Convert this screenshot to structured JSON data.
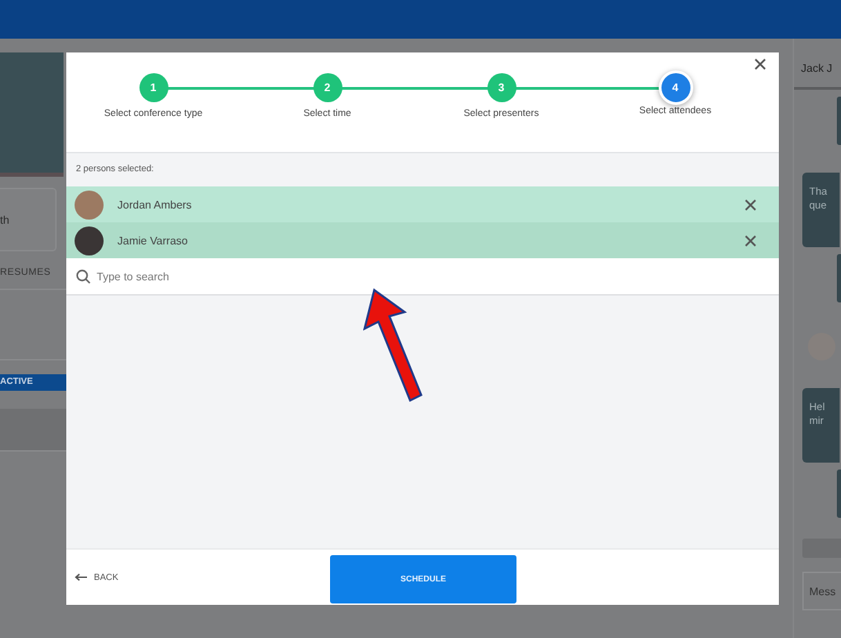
{
  "left_panel": {
    "card_text": "th",
    "section_label": "RESUMES",
    "status_bar": "ACTIVE"
  },
  "right_panel": {
    "header": "Jack J",
    "bubbles": [
      {
        "lines": [
          "Tha",
          "que"
        ]
      },
      {
        "lines": [
          "Hel",
          "mir"
        ]
      }
    ],
    "message_placeholder": "Mess"
  },
  "modal": {
    "steps": [
      {
        "number": "1",
        "label": "Select conference type",
        "completed": true
      },
      {
        "number": "2",
        "label": "Select time",
        "completed": true
      },
      {
        "number": "3",
        "label": "Select presenters",
        "completed": true
      },
      {
        "number": "4",
        "label": "Select attendees",
        "completed": false
      }
    ],
    "selected_count": "2 persons selected:",
    "attendees": [
      {
        "name": "Jordan Ambers",
        "highlighted": false
      },
      {
        "name": "Jamie Varraso",
        "highlighted": true
      }
    ],
    "search": {
      "placeholder": "Type to search"
    },
    "back": "BACK",
    "schedule": "SCHEDULE"
  }
}
